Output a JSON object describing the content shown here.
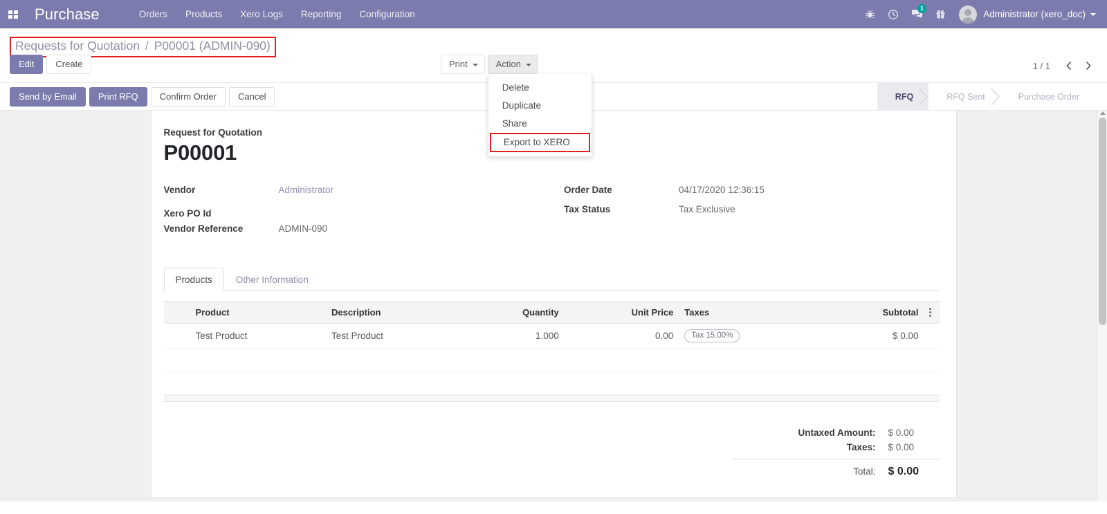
{
  "navbar": {
    "apps_icon": "apps-grid-icon",
    "brand": "Purchase",
    "menu": [
      {
        "label": "Orders"
      },
      {
        "label": "Products"
      },
      {
        "label": "Xero Logs"
      },
      {
        "label": "Reporting"
      },
      {
        "label": "Configuration"
      }
    ],
    "icons": [
      {
        "name": "debug-bug-icon"
      },
      {
        "name": "clock-icon"
      },
      {
        "name": "messages-icon",
        "badge": "1"
      },
      {
        "name": "gift-icon"
      }
    ],
    "user": {
      "name": "Administrator (xero_doc)",
      "avatar": "user-avatar"
    },
    "accent_color": "#7c7bad",
    "badge_color": "#00a09d"
  },
  "control_panel": {
    "breadcrumb": {
      "root": "Requests for Quotation",
      "separator": "/",
      "current": "P00001 (ADMIN-090)",
      "highlight_color": "#e02020"
    },
    "edit_label": "Edit",
    "create_label": "Create",
    "print_label": "Print",
    "action_label": "Action",
    "action_menu": [
      {
        "label": "Delete",
        "highlighted": false
      },
      {
        "label": "Duplicate",
        "highlighted": false
      },
      {
        "label": "Share",
        "highlighted": false
      },
      {
        "label": "Export to XERO",
        "highlighted": true
      }
    ],
    "pager": {
      "value": "1 / 1",
      "prev_icon": "chevron-left-icon",
      "next_icon": "chevron-right-icon"
    }
  },
  "statusbar": {
    "buttons": [
      {
        "label": "Send by Email",
        "primary": true
      },
      {
        "label": "Print RFQ",
        "primary": true
      },
      {
        "label": "Confirm Order",
        "primary": false
      },
      {
        "label": "Cancel",
        "primary": false
      }
    ],
    "steps": [
      {
        "label": "RFQ",
        "active": true
      },
      {
        "label": "RFQ Sent",
        "active": false
      },
      {
        "label": "Purchase Order",
        "active": false
      }
    ]
  },
  "form": {
    "title_sub": "Request for Quotation",
    "title_main": "P00001",
    "fields_left": [
      {
        "label": "Vendor",
        "value": "Administrator",
        "style": "link"
      },
      {
        "label": "Xero PO Id",
        "value": "",
        "style": "plain"
      },
      {
        "label": "Vendor Reference",
        "value": "ADMIN-090",
        "style": "plain"
      }
    ],
    "fields_right": [
      {
        "label": "Order Date",
        "value": "04/17/2020 12:36:15",
        "style": "plain"
      },
      {
        "label": "Tax Status",
        "value": "Tax Exclusive",
        "style": "plain"
      }
    ],
    "tabs": [
      {
        "label": "Products",
        "active": true
      },
      {
        "label": "Other Information",
        "active": false
      }
    ],
    "lines_table": {
      "columns": [
        "Product",
        "Description",
        "Quantity",
        "Unit Price",
        "Taxes",
        "Subtotal"
      ],
      "optional_columns_icon": "vertical-dots-icon",
      "rows": [
        {
          "product": "Test Product",
          "description": "Test Product",
          "quantity": "1.000",
          "unit_price": "0.00",
          "taxes": "Tax 15.00%",
          "subtotal": "$ 0.00"
        }
      ],
      "empty_rows": 2
    },
    "totals": [
      {
        "label": "Untaxed Amount:",
        "value": "$ 0.00",
        "grand": false
      },
      {
        "label": "Taxes:",
        "value": "$ 0.00",
        "grand": false
      },
      {
        "label": "Total:",
        "value": "$ 0.00",
        "grand": true
      }
    ]
  }
}
